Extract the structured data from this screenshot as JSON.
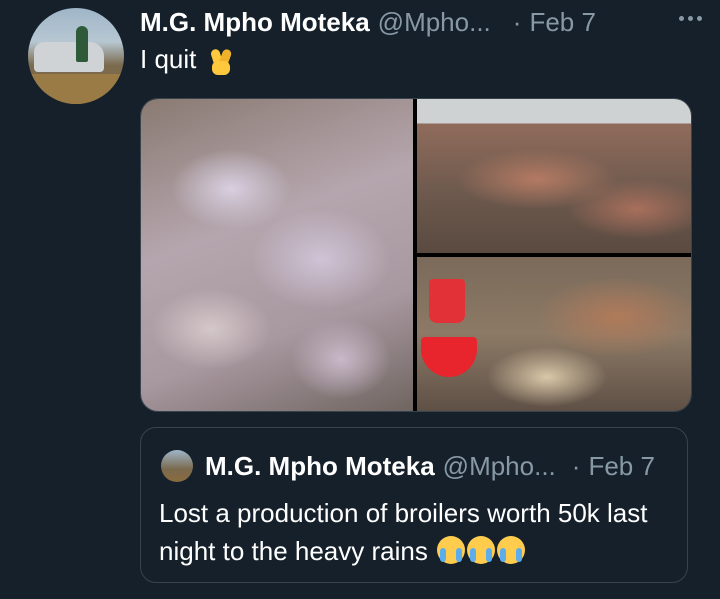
{
  "tweet": {
    "author_name": "M.G. Mpho Moteka",
    "handle": "@Mpho...",
    "separator": "·",
    "date": "Feb 7",
    "text": "I quit",
    "emoji": "crossed-fingers"
  },
  "media": {
    "images": [
      "dead-broilers-pile",
      "dead-broilers-floor",
      "broilers-with-buckets"
    ]
  },
  "quoted_tweet": {
    "author_name": "M.G. Mpho Moteka",
    "handle": "@Mpho...",
    "separator": "·",
    "date": "Feb 7",
    "text": "Lost a production of broilers worth 50k last night to the heavy rains",
    "emojis": [
      "crying-face",
      "crying-face",
      "crying-face"
    ]
  },
  "colors": {
    "background": "#15202b",
    "text_primary": "#ffffff",
    "text_secondary": "#8899a6",
    "border": "#38444d"
  }
}
